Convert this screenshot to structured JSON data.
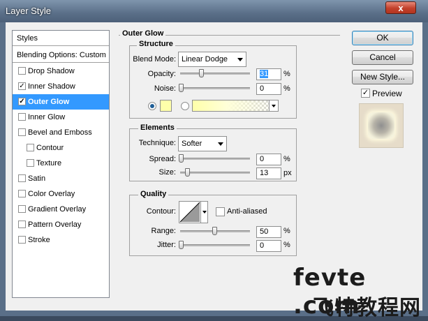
{
  "window": {
    "title": "Layer Style",
    "close_glyph": "x"
  },
  "styles_list": {
    "header": "Styles",
    "blending": "Blending Options: Custom",
    "items": [
      {
        "label": "Drop Shadow",
        "checked": false
      },
      {
        "label": "Inner Shadow",
        "checked": true
      },
      {
        "label": "Outer Glow",
        "checked": true,
        "selected": true
      },
      {
        "label": "Inner Glow",
        "checked": false
      },
      {
        "label": "Bevel and Emboss",
        "checked": false
      },
      {
        "label": "Contour",
        "checked": false,
        "indent": true
      },
      {
        "label": "Texture",
        "checked": false,
        "indent": true
      },
      {
        "label": "Satin",
        "checked": false
      },
      {
        "label": "Color Overlay",
        "checked": false
      },
      {
        "label": "Gradient Overlay",
        "checked": false
      },
      {
        "label": "Pattern Overlay",
        "checked": false
      },
      {
        "label": "Stroke",
        "checked": false
      }
    ]
  },
  "outer_glow": {
    "title": "Outer Glow",
    "structure": {
      "title": "Structure",
      "blend_mode_label": "Blend Mode:",
      "blend_mode_value": "Linear Dodge",
      "opacity_label": "Opacity:",
      "opacity_value": "31",
      "opacity_unit": "%",
      "noise_label": "Noise:",
      "noise_value": "0",
      "noise_unit": "%",
      "color": "#ffffaa"
    },
    "elements": {
      "title": "Elements",
      "technique_label": "Technique:",
      "technique_value": "Softer",
      "spread_label": "Spread:",
      "spread_value": "0",
      "spread_unit": "%",
      "size_label": "Size:",
      "size_value": "13",
      "size_unit": "px"
    },
    "quality": {
      "title": "Quality",
      "contour_label": "Contour:",
      "anti_aliased_label": "Anti-aliased",
      "range_label": "Range:",
      "range_value": "50",
      "range_unit": "%",
      "jitter_label": "Jitter:",
      "jitter_value": "0",
      "jitter_unit": "%"
    }
  },
  "buttons": {
    "ok": "OK",
    "cancel": "Cancel",
    "new_style": "New Style..."
  },
  "preview": {
    "label": "Preview",
    "checked": true
  },
  "watermark": {
    "line1": "fevte .com",
    "line2": "飞特教程网"
  }
}
